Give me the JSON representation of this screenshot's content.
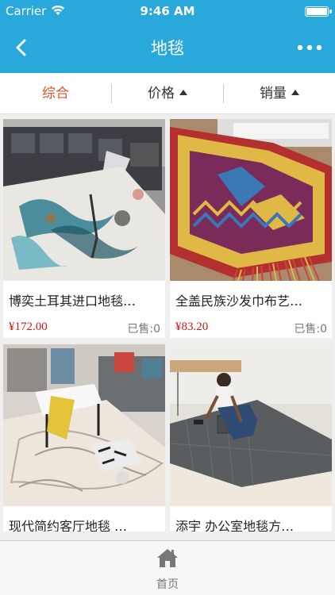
{
  "status_bar": {
    "carrier": "Carrier",
    "time": "9:46 AM"
  },
  "nav": {
    "title": "地毯"
  },
  "sort": {
    "comprehensive": "综合",
    "price": "价格",
    "sales": "销量"
  },
  "products": [
    {
      "name": "博奕土耳其进口地毯…",
      "price": "¥172.00",
      "sold": "已售:0"
    },
    {
      "name": "全盖民族沙发巾布艺…",
      "price": "¥83.20",
      "sold": "已售:0"
    },
    {
      "name": "现代简约客厅地毯 …",
      "price": "",
      "sold": ""
    },
    {
      "name": "添宇 办公室地毯方…",
      "price": "",
      "sold": ""
    }
  ],
  "tab_bar": {
    "home_label": "首页"
  }
}
